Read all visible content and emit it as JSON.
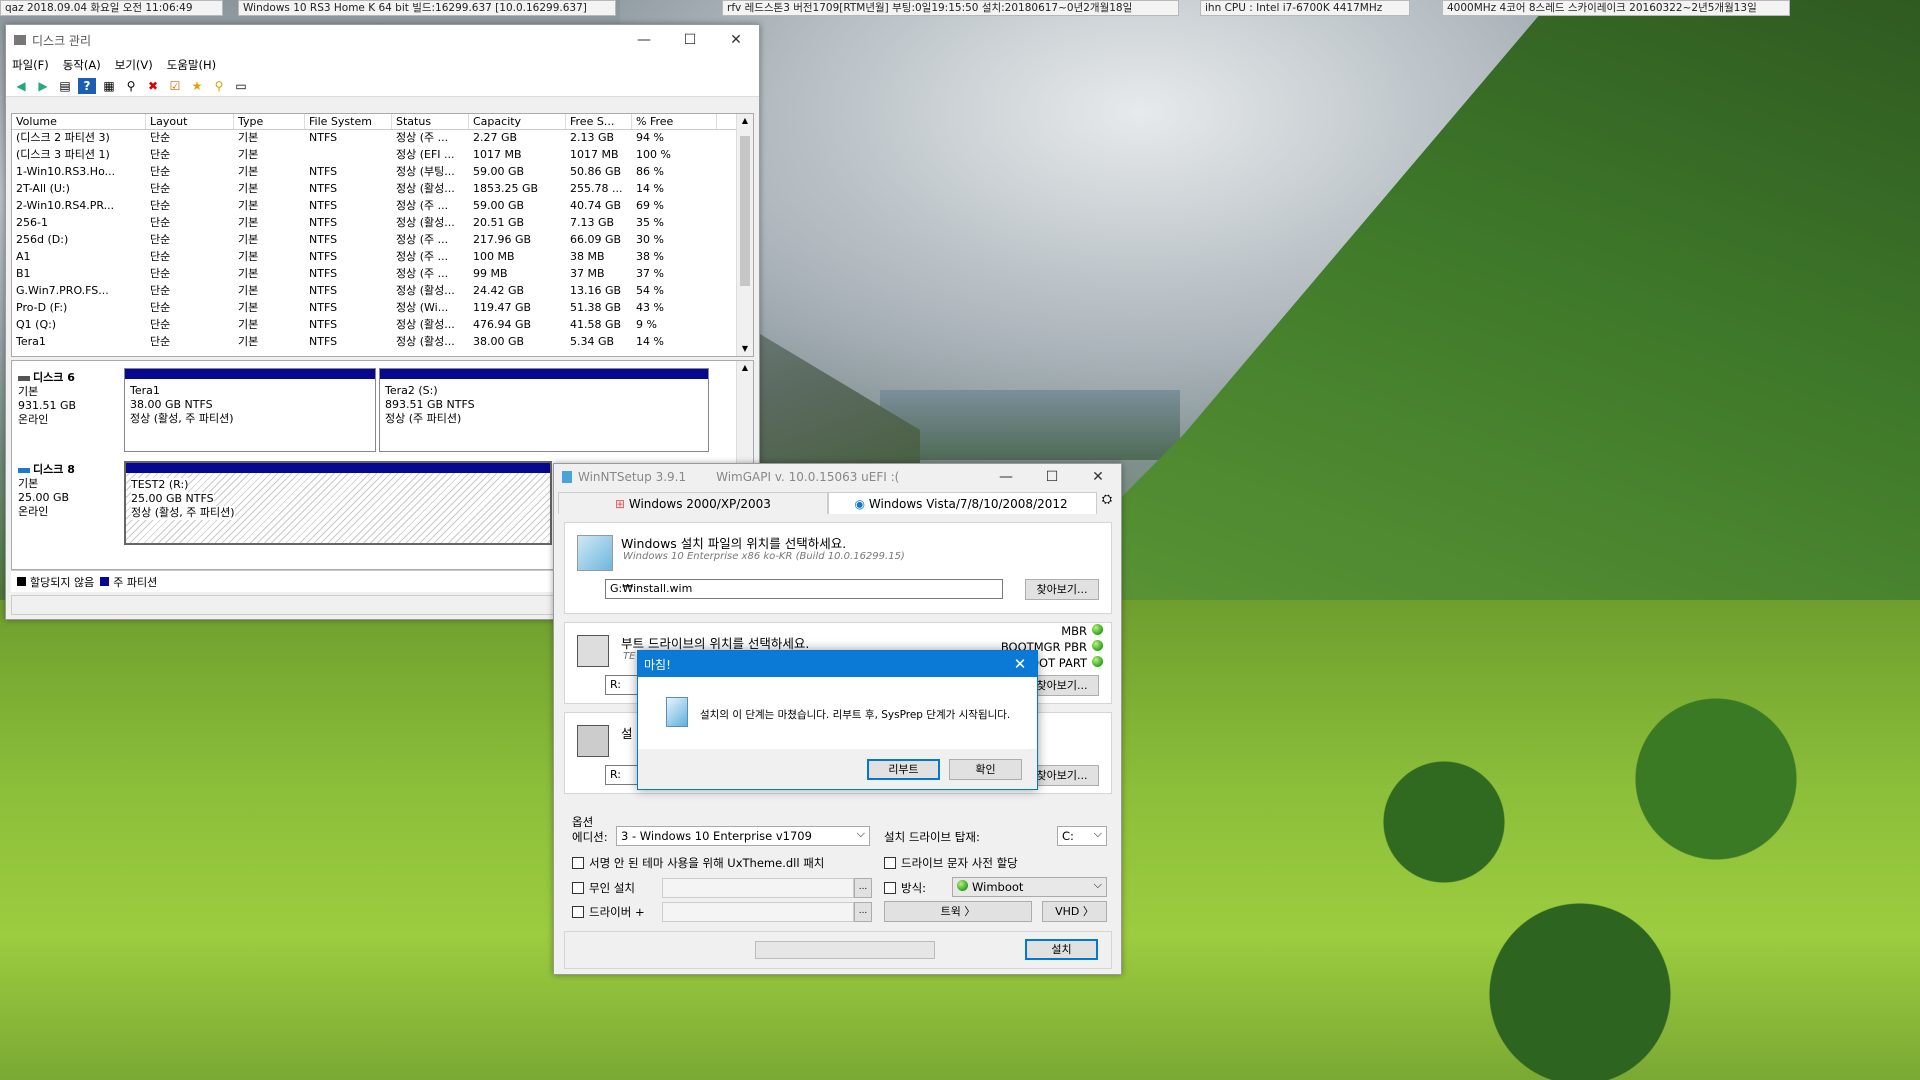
{
  "topbar": {
    "clock": "qaz 2018.09.04 화요일 오전 11:06:49",
    "os": "Windows 10 RS3 Home K 64 bit 빌드:16299.637 [10.0.16299.637]",
    "boot": "rfv 레드스톤3 버전1709[RTM년월] 부팅:0일19:15:50 설치:20180617~0년2개월18일",
    "cpu": "ihn CPU : Intel i7-6700K 4417MHz",
    "cpu_detail": "4000MHz 4코어 8스레드 스카이레이크 20160322~2년5개월13일"
  },
  "diskmgmt": {
    "title": "디스크 관리",
    "menu": [
      "파일(F)",
      "동작(A)",
      "보기(V)",
      "도움말(H)"
    ],
    "columns": [
      "Volume",
      "Layout",
      "Type",
      "File System",
      "Status",
      "Capacity",
      "Free S...",
      "% Free"
    ],
    "rows": [
      [
        "(디스크 2 파티션 3)",
        "단순",
        "기본",
        "NTFS",
        "정상 (주 ...",
        "2.27 GB",
        "2.13 GB",
        "94 %"
      ],
      [
        "(디스크 3 파티션 1)",
        "단순",
        "기본",
        "",
        "정상 (EFI ...",
        "1017 MB",
        "1017 MB",
        "100 %"
      ],
      [
        "1-Win10.RS3.Ho...",
        "단순",
        "기본",
        "NTFS",
        "정상 (부팅...",
        "59.00 GB",
        "50.86 GB",
        "86 %"
      ],
      [
        "2T-All (U:)",
        "단순",
        "기본",
        "NTFS",
        "정상 (활성...",
        "1853.25 GB",
        "255.78 ...",
        "14 %"
      ],
      [
        "2-Win10.RS4.PR...",
        "단순",
        "기본",
        "NTFS",
        "정상 (주 ...",
        "59.00 GB",
        "40.74 GB",
        "69 %"
      ],
      [
        "256-1",
        "단순",
        "기본",
        "NTFS",
        "정상 (활성...",
        "20.51 GB",
        "7.13 GB",
        "35 %"
      ],
      [
        "256d (D:)",
        "단순",
        "기본",
        "NTFS",
        "정상 (주 ...",
        "217.96 GB",
        "66.09 GB",
        "30 %"
      ],
      [
        "A1",
        "단순",
        "기본",
        "NTFS",
        "정상 (주 ...",
        "100 MB",
        "38 MB",
        "38 %"
      ],
      [
        "B1",
        "단순",
        "기본",
        "NTFS",
        "정상 (주 ...",
        "99 MB",
        "37 MB",
        "37 %"
      ],
      [
        "G.Win7.PRO.FS...",
        "단순",
        "기본",
        "NTFS",
        "정상 (활성...",
        "24.42 GB",
        "13.16 GB",
        "54 %"
      ],
      [
        "Pro-D (F:)",
        "단순",
        "기본",
        "NTFS",
        "정상 (Wi...",
        "119.47 GB",
        "51.38 GB",
        "43 %"
      ],
      [
        "Q1 (Q:)",
        "단순",
        "기본",
        "NTFS",
        "정상 (활성...",
        "476.94 GB",
        "41.58 GB",
        "9 %"
      ],
      [
        "Tera1",
        "단순",
        "기본",
        "NTFS",
        "정상 (활성...",
        "38.00 GB",
        "5.34 GB",
        "14 %"
      ]
    ],
    "disk6": {
      "name": "디스크 6",
      "type": "기본",
      "size": "931.51 GB",
      "state": "온라인",
      "p1": {
        "name": "Tera1",
        "size": "38.00 GB NTFS",
        "status": "정상 (활성, 주 파티션)"
      },
      "p2": {
        "name": "Tera2  (S:)",
        "size": "893.51 GB NTFS",
        "status": "정상 (주 파티션)"
      }
    },
    "disk8": {
      "name": "디스크 8",
      "type": "기본",
      "size": "25.00 GB",
      "state": "온라인",
      "p1": {
        "name": "TEST2  (R:)",
        "size": "25.00 GB NTFS",
        "status": "정상 (활성, 주 파티션)"
      }
    },
    "legend": {
      "unallocated": "할당되지 않음",
      "primary": "주 파티션"
    }
  },
  "winnt": {
    "title": "WinNTSetup 3.9.1",
    "wimgapi": "WimGAPI v. 10.0.15063   uEFI :(",
    "tab_xp": "Windows 2000/XP/2003",
    "tab_vista": "Windows Vista/7/8/10/2008/2012",
    "src_heading": "Windows 설치 파일의 위치를 선택하세요.",
    "src_sub": "Windows 10 Enterprise x86 ko-KR (Build 10.0.16299.15)",
    "src_path": "G:₩install.wim",
    "browse": "찾아보기...",
    "boot_heading": "부트 드라이브의 위치를 선택하세요.",
    "boot_sub": "TE",
    "boot_path": "R:",
    "mbr": "MBR",
    "bootmgr": "BOOTMGR PBR",
    "bootpart": "BOOT PART",
    "inst_heading": "설",
    "inst_path": "R:",
    "options_label": "옵션",
    "edition_label": "에디션:",
    "edition_value": "3 - Windows 10 Enterprise v1709",
    "mount_label": "설치 드라이브 탑재:",
    "mount_value": "C:",
    "opt_uxtheme": "서명 안 된 테마 사용을 위해 UxTheme.dll 패치",
    "opt_letter": "드라이브 문자 사전 할당",
    "opt_unattend": "무인 설치",
    "opt_mode": "방식:",
    "mode_value": "Wimboot",
    "opt_driver": "드라이버 +",
    "tweaks": "트윅 〉",
    "vhd": "VHD 〉",
    "install": "설치"
  },
  "dialog": {
    "title": "마침!",
    "message": "설치의 이 단계는 마쳤습니다. 리부트 후, SysPrep 단계가 시작됩니다.",
    "reboot": "리부트",
    "ok": "확인"
  }
}
